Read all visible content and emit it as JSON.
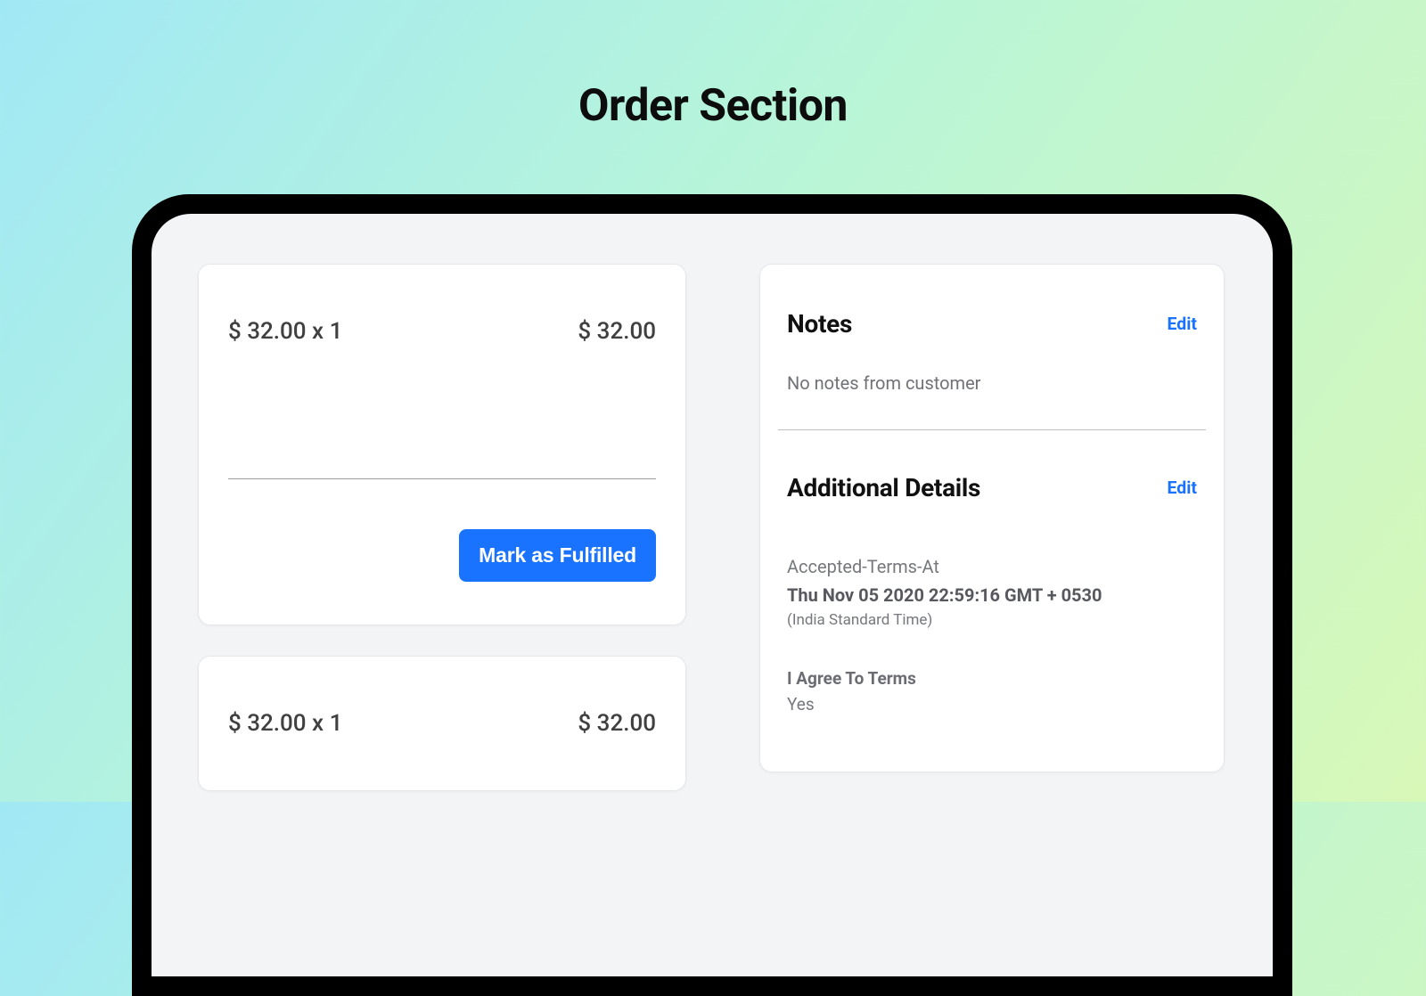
{
  "page": {
    "heading": "Order Section"
  },
  "orders": {
    "item1": {
      "line": "$ 32.00 x 1",
      "total": "$ 32.00"
    },
    "item2": {
      "line": "$ 32.00 x 1",
      "total": "$ 32.00"
    },
    "fulfill_button": "Mark as Fulfilled"
  },
  "notes": {
    "title": "Notes",
    "edit": "Edit",
    "empty": "No notes from customer"
  },
  "additional": {
    "title": "Additional Details",
    "edit": "Edit",
    "accepted_label": "Accepted-Terms-At",
    "accepted_value": "Thu Nov 05 2020 22:59:16 GMT + 0530",
    "accepted_tz": "(India Standard Time)",
    "agree_label": "I Agree To Terms",
    "agree_value": "Yes"
  }
}
